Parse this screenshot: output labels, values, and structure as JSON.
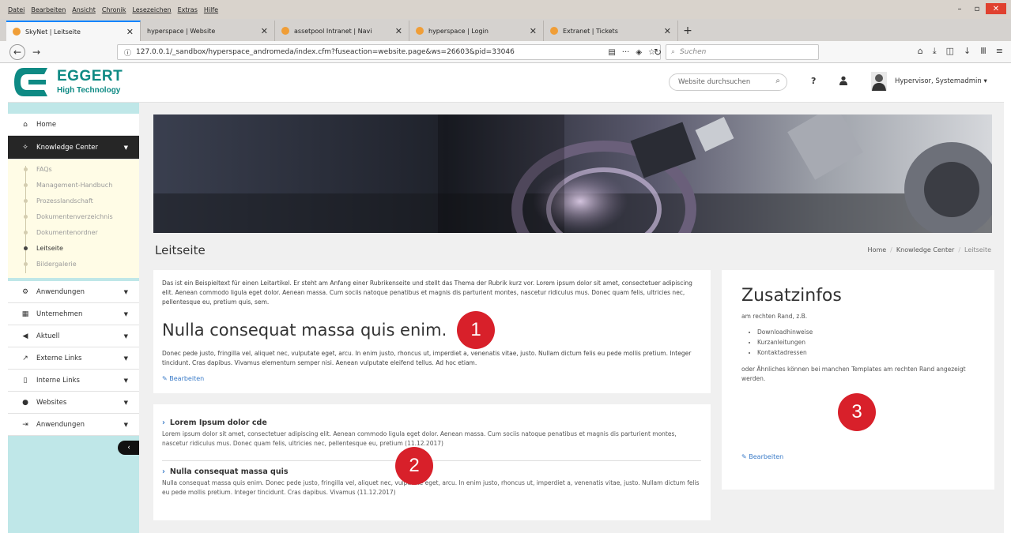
{
  "browser": {
    "menu": [
      "Datei",
      "Bearbeiten",
      "Ansicht",
      "Chronik",
      "Lesezeichen",
      "Extras",
      "Hilfe"
    ],
    "tabs": [
      {
        "label": "SkyNet | Leitseite"
      },
      {
        "label": "hyperspace | Website"
      },
      {
        "label": "assetpool Intranet | Navi"
      },
      {
        "label": "hyperspace | Login"
      },
      {
        "label": "Extranet | Tickets"
      }
    ],
    "url": "127.0.0.1/_sandbox/hyperspace_andromeda/index.cfm?fuseaction=website.page&ws=26603&pid=33046",
    "search_placeholder": "Suchen"
  },
  "header": {
    "logo_name": "EGGERT",
    "logo_sub": "High Technology",
    "search_placeholder": "Website durchsuchen",
    "help": "?",
    "user": "Hypervisor, Systemadmin ▾"
  },
  "sidebar": {
    "home": "Home",
    "knowledge": "Knowledge Center",
    "sub": [
      "FAQs",
      "Management-Handbuch",
      "Prozesslandschaft",
      "Dokumentenverzeichnis",
      "Dokumentenordner",
      "Leitseite",
      "Bildergalerie"
    ],
    "items": [
      "Anwendungen",
      "Unternehmen",
      "Aktuell",
      "Externe Links",
      "Interne Links",
      "Websites",
      "Anwendungen"
    ]
  },
  "main": {
    "page_title": "Leitseite",
    "breadcrumb": [
      "Home",
      "Knowledge Center",
      "Leitseite"
    ],
    "intro_text": "Das ist ein Beispieltext für einen Leitartikel. Er steht am Anfang einer Rubrikenseite und stellt das Thema der Rubrik kurz vor. Lorem ipsum dolor sit amet, consectetuer adipiscing elit. Aenean commodo ligula eget dolor. Aenean massa. Cum sociis natoque penatibus et magnis dis parturient montes, nascetur ridiculus mus. Donec quam felis, ultricies nec, pellentesque eu, pretium quis, sem.",
    "intro_heading": "Nulla consequat massa quis enim.",
    "intro_body": "Donec pede justo, fringilla vel, aliquet nec, vulputate eget, arcu. In enim justo, rhoncus ut, imperdiet a, venenatis vitae, justo. Nullam dictum felis eu pede mollis pretium. Integer tincidunt. Cras dapibus. Vivamus elementum semper nisi. Aenean vulputate eleifend tellus. Ad hoc etiam.",
    "edit_label": "Bearbeiten",
    "news": [
      {
        "title": "Lorem Ipsum dolor cde",
        "text": "Lorem ipsum dolor sit amet, consectetuer adipiscing elit. Aenean commodo ligula eget dolor. Aenean massa. Cum sociis natoque penatibus et magnis dis parturient montes, nascetur ridiculus mus. Donec quam felis, ultricies nec, pellentesque eu, pretium (11.12.2017)"
      },
      {
        "title": "Nulla consequat massa quis",
        "text": "Nulla consequat massa quis enim. Donec pede justo, fringilla vel, aliquet nec, vulputate eget, arcu. In enim justo, rhoncus ut, imperdiet a, venenatis vitae, justo. Nullam dictum felis eu pede mollis pretium. Integer tincidunt. Cras dapibus. Vivamus (11.12.2017)"
      }
    ]
  },
  "aside": {
    "title": "Zusatzinfos",
    "sub": "am rechten Rand, z.B.",
    "list": [
      "Downloadhinweise",
      "Kurzanleitungen",
      "Kontaktadressen"
    ],
    "foot": "oder Ähnliches können bei manchen Templates am rechten Rand angezeigt werden.",
    "edit_label": "Bearbeiten"
  },
  "badges": [
    "1",
    "2",
    "3"
  ],
  "colors": {
    "brand": "#0e8a84",
    "badge": "#d8202a",
    "sidebar_bg": "#bfe7e8",
    "link": "#3a7bc8"
  }
}
